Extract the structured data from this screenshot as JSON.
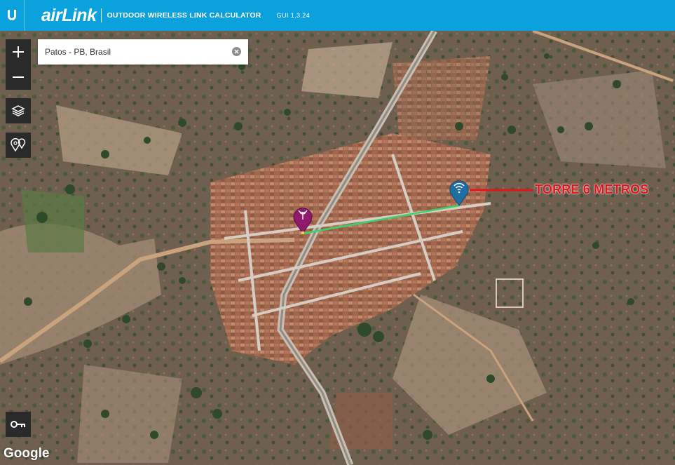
{
  "header": {
    "brand_air": "air",
    "brand_link": "Link",
    "subtitle": "OUTDOOR WIRELESS LINK CALCULATOR",
    "version": "GUI 1.3.24",
    "logo_icon": "ubiquiti-u-icon"
  },
  "search": {
    "value": "Patos - PB, Brasil",
    "clear_icon": "clear-icon"
  },
  "controls": {
    "zoom_in": "plus-icon",
    "zoom_out": "minus-icon",
    "layers": "layers-icon",
    "markers": "markers-icon",
    "key": "key-icon"
  },
  "map": {
    "annotation": "TORRE 6 METROS",
    "attribution": "Google",
    "link_color": "#3ad26a",
    "annotation_color": "#e3141b",
    "station_a_color": "#8e1a6b",
    "station_b_color": "#1f6fa3"
  }
}
